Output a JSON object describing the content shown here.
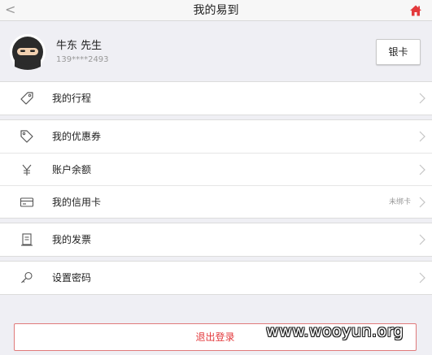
{
  "navbar": {
    "title": "我的易到",
    "back_icon": "chevron-left-icon",
    "home_icon": "home-icon"
  },
  "profile": {
    "name": "牛东 先生",
    "phone": "139****2493",
    "card_button": "银卡",
    "avatar_icon": "ninja-avatar-icon"
  },
  "menu": {
    "trips": {
      "label": "我的行程",
      "icon": "tag-outline-icon"
    },
    "coupons": {
      "label": "我的优惠券",
      "icon": "coupon-tag-icon"
    },
    "balance": {
      "label": "账户余额",
      "icon": "yen-icon"
    },
    "credit_card": {
      "label": "我的信用卡",
      "icon": "credit-card-icon",
      "badge": "未绑卡"
    },
    "invoice": {
      "label": "我的发票",
      "icon": "receipt-icon"
    },
    "password": {
      "label": "设置密码",
      "icon": "key-icon"
    }
  },
  "logout_label": "退出登录",
  "watermark": "www.wooyun.org",
  "colors": {
    "accent": "#e3393c",
    "background": "#efeff4"
  }
}
